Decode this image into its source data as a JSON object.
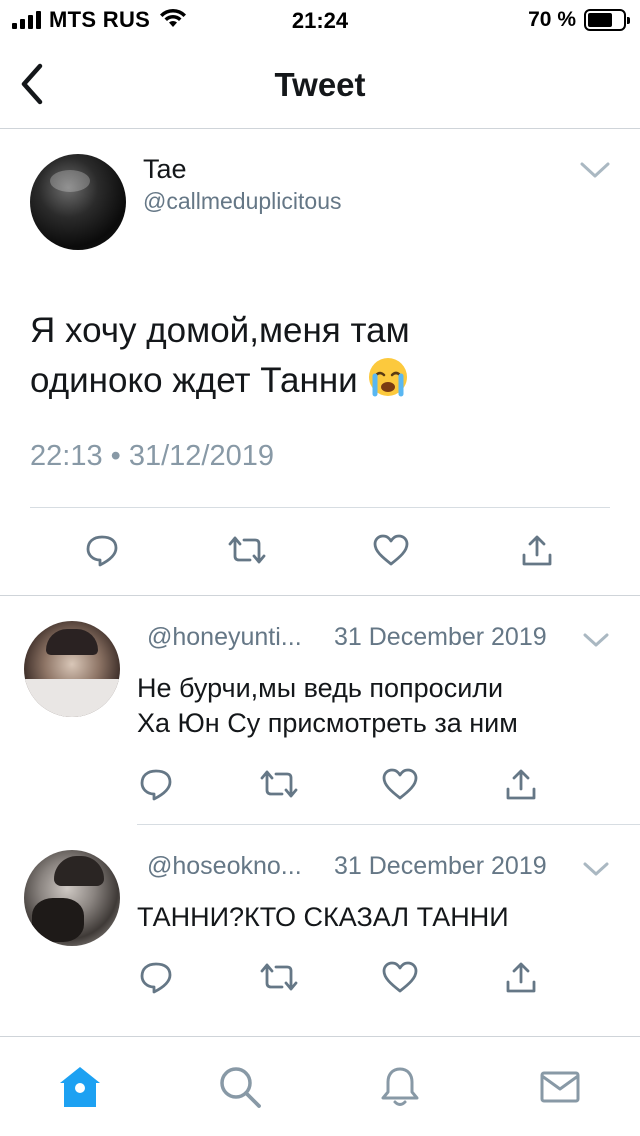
{
  "status_bar": {
    "carrier": "MTS RUS",
    "time": "21:24",
    "battery_percent": "70 %",
    "battery_level": 0.7
  },
  "nav": {
    "title": "Tweet",
    "back_icon": "chevron-left-icon"
  },
  "tweet": {
    "author_name": "Tae",
    "author_handle": "@callmeduplicitous",
    "text_line1": "Я хочу домой,меня там",
    "text_line2": "одиноко ждет Танни ",
    "emoji": "crying-face-emoji",
    "timestamp": "22:13 • 31/12/2019",
    "actions": [
      "reply-icon",
      "retweet-icon",
      "like-icon",
      "share-icon"
    ]
  },
  "replies": [
    {
      "handle": "@honeyunti...",
      "date": "31 December 2019",
      "text_line1": "Не бурчи,мы ведь попросили",
      "text_line2": "Ха Юн Су присмотреть за ним"
    },
    {
      "handle": "@hoseokno...",
      "date": "31 December 2019",
      "text_line1": "ТАННИ?КТО СКАЗАЛ ТАННИ",
      "text_line2": ""
    }
  ],
  "tab_bar": {
    "tabs": [
      "home-icon",
      "search-icon",
      "notifications-icon",
      "messages-icon"
    ],
    "active": "home-icon",
    "active_color": "#1da1f2",
    "inactive_color": "#8899a6"
  }
}
